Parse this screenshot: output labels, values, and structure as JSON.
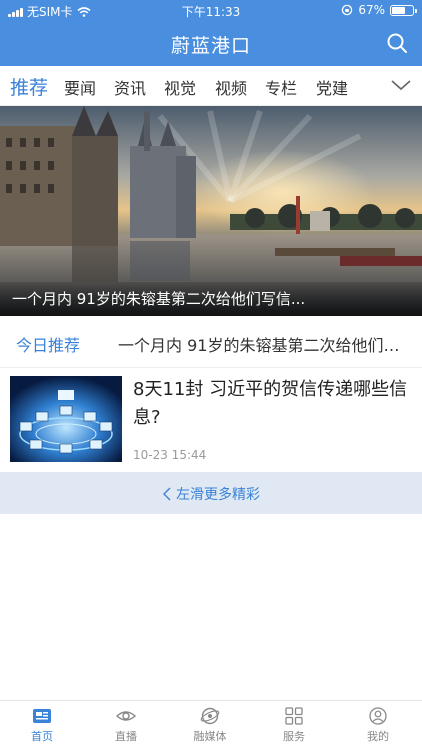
{
  "status": {
    "carrier": "无SIM卡",
    "time": "下午11:33",
    "battery": "67%"
  },
  "app": {
    "title": "蔚蓝港口"
  },
  "tabs": [
    "推荐",
    "要闻",
    "资讯",
    "视觉",
    "视频",
    "专栏",
    "党建"
  ],
  "hero": {
    "caption": "一个月内 91岁的朱镕基第二次给他们写信..."
  },
  "today": {
    "label": "今日推荐",
    "text": "一个月内 91岁的朱镕基第二次给他们写信"
  },
  "news": [
    {
      "title": "8天11封 习近平的贺信传递哪些信息?",
      "time": "10-23 15:44"
    }
  ],
  "swipe_hint": "左滑更多精彩",
  "bottom_nav": [
    "首页",
    "直播",
    "融媒体",
    "服务",
    "我的"
  ],
  "colors": {
    "brand": "#4a8fdf",
    "accent": "#3a82d8"
  }
}
